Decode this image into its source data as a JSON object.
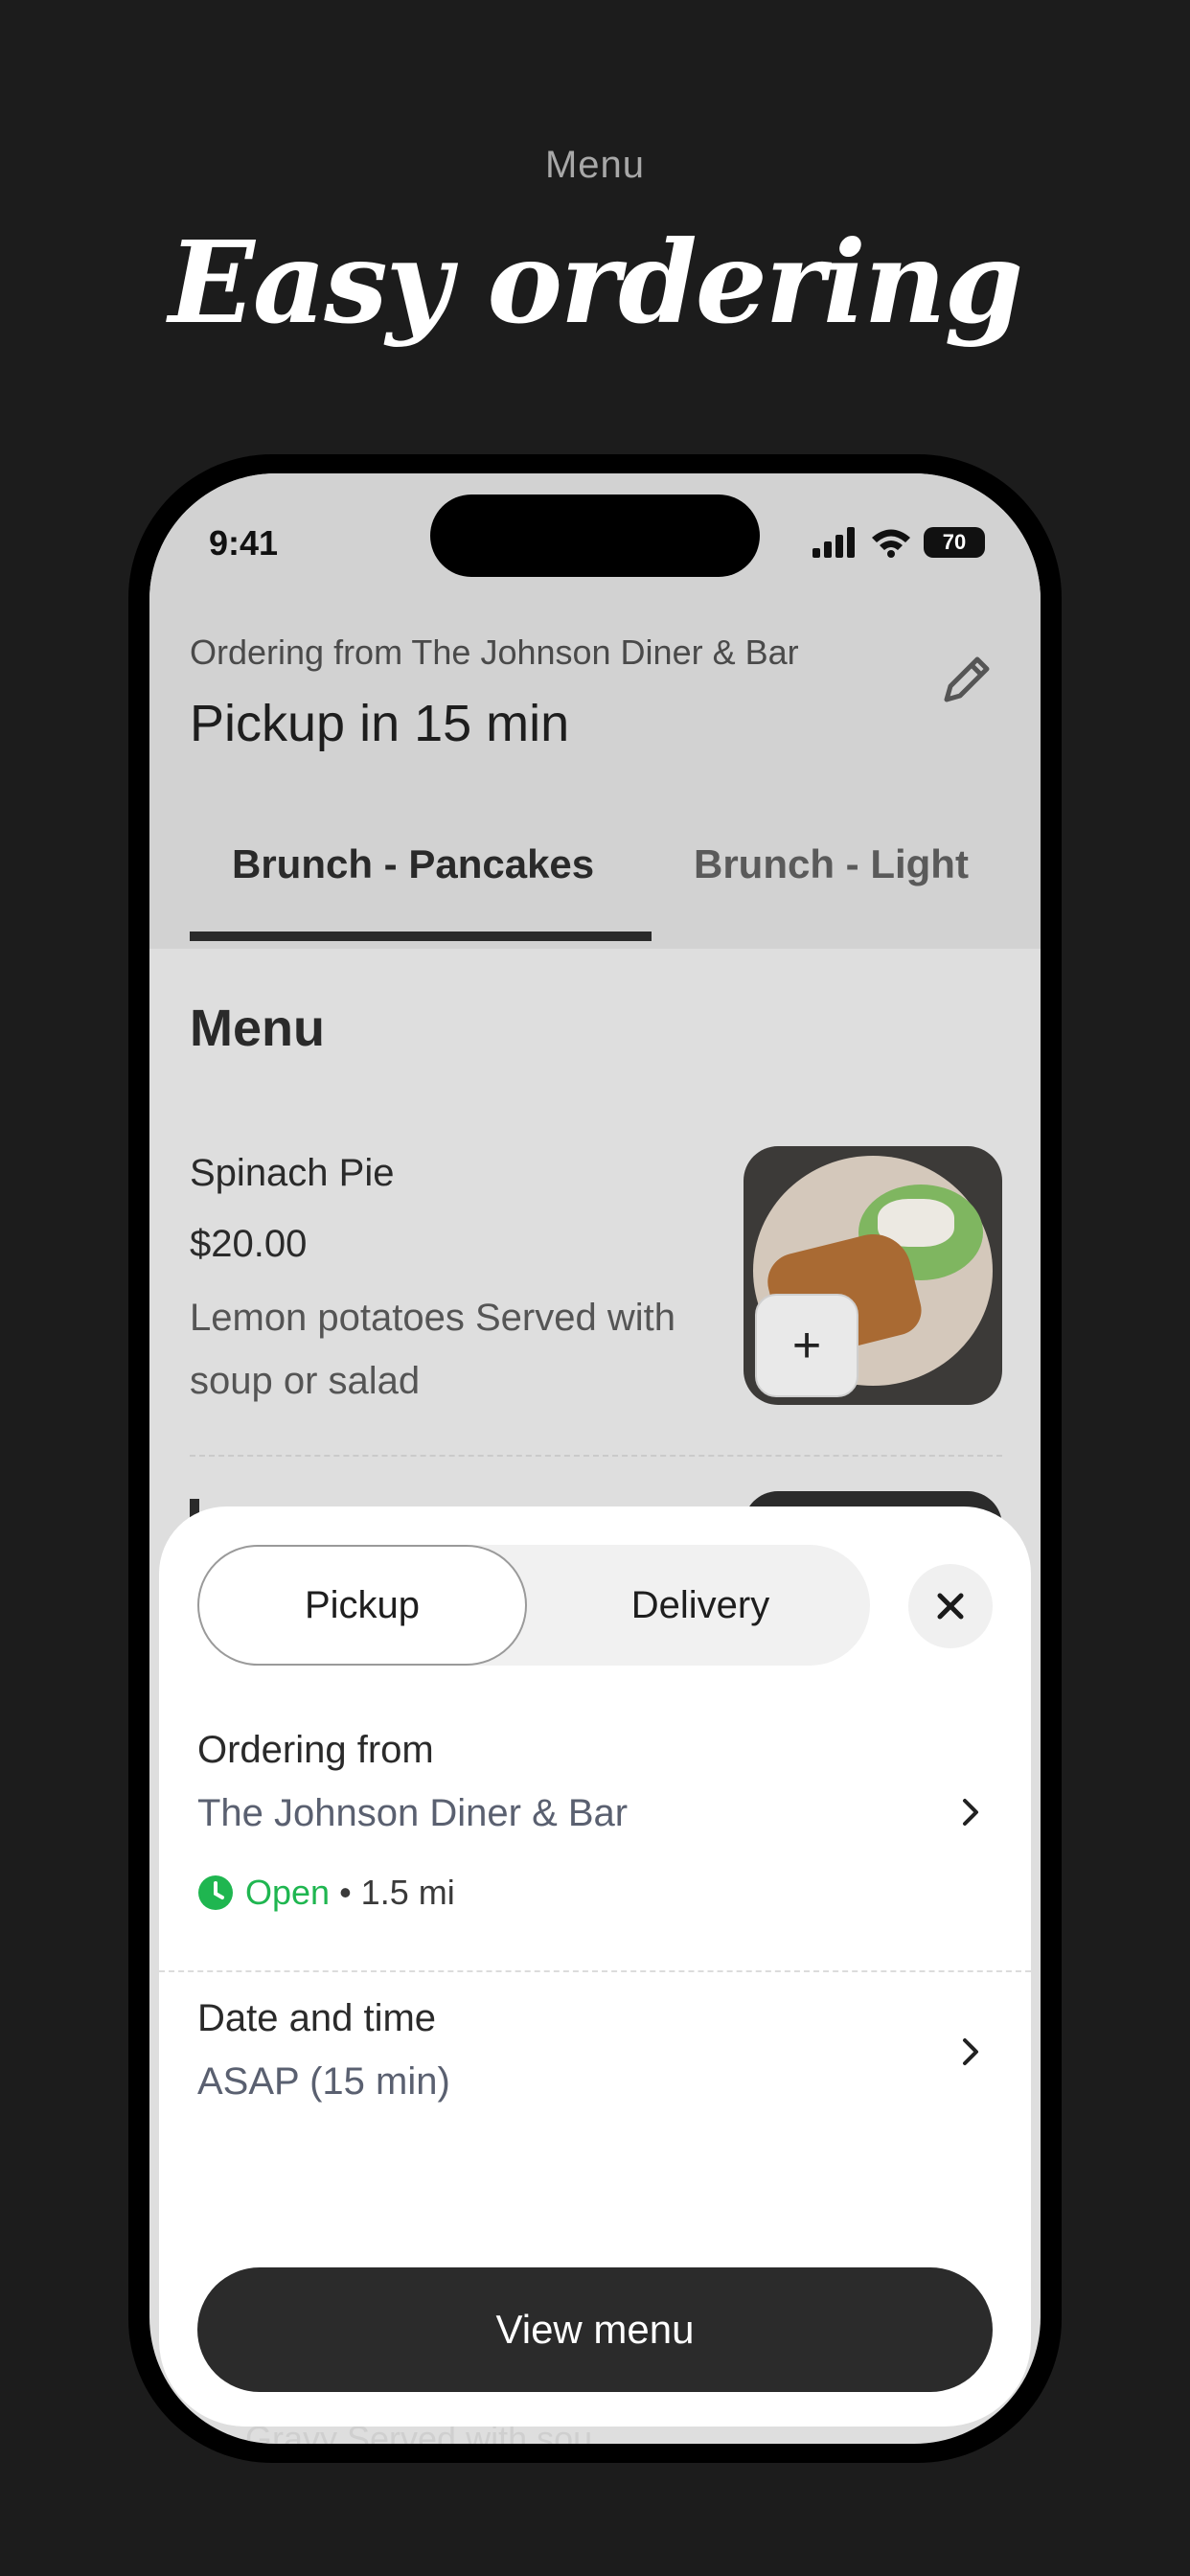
{
  "promo": {
    "subtitle": "Menu",
    "title": "Easy ordering"
  },
  "status_bar": {
    "time": "9:41",
    "battery": "70"
  },
  "header": {
    "ordering_from": "Ordering from The Johnson Diner & Bar",
    "pickup": "Pickup in 15 min"
  },
  "tabs": [
    {
      "label": "Brunch - Pancakes",
      "active": true
    },
    {
      "label": "Brunch - Light",
      "active": false
    }
  ],
  "menu": {
    "section_title": "Menu",
    "items": [
      {
        "name": "Spinach Pie",
        "price": "$20.00",
        "description": "Lemon potatoes Served with soup or salad",
        "add_label": "+"
      }
    ],
    "peek_text": "Gravy Served with sou"
  },
  "sheet": {
    "modes": [
      "Pickup",
      "Delivery"
    ],
    "selected_mode": "Pickup",
    "ordering_from_label": "Ordering from",
    "restaurant": "The Johnson Diner & Bar",
    "status": "Open",
    "distance": "• 1.5 mi",
    "date_time_label": "Date and time",
    "date_time_value": "ASAP (15 min)",
    "cta": "View menu"
  },
  "colors": {
    "background": "#1c1c1c",
    "open_green": "#1fb650",
    "cta": "#2b2b2b"
  },
  "icons": [
    "edit-icon",
    "signal-icon",
    "wifi-icon",
    "battery-icon",
    "plus-icon",
    "close-icon",
    "clock-icon",
    "chevron-right-icon"
  ]
}
